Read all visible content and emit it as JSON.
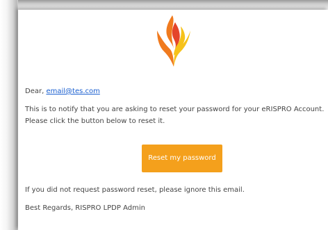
{
  "email": {
    "greeting_prefix": "Dear, ",
    "recipient_email": "email@tes.com",
    "message_line1": "This is to notify that you are asking to reset your password for your eRISPRO Account.",
    "message_line2": "Please click the button below to reset it.",
    "reset_button_label": "Reset my password",
    "ignore_note": "If you did not request password reset, please ignore this email.",
    "signature": "Best Regards, RISPRO LPDP Admin"
  },
  "colors": {
    "button": "#f4a01c",
    "link": "#1a5fd0",
    "logo_orange": "#f07a1e",
    "logo_yellow": "#f6c21a",
    "logo_red": "#e4452a"
  },
  "logo": {
    "icon": "flame-logo-icon"
  }
}
